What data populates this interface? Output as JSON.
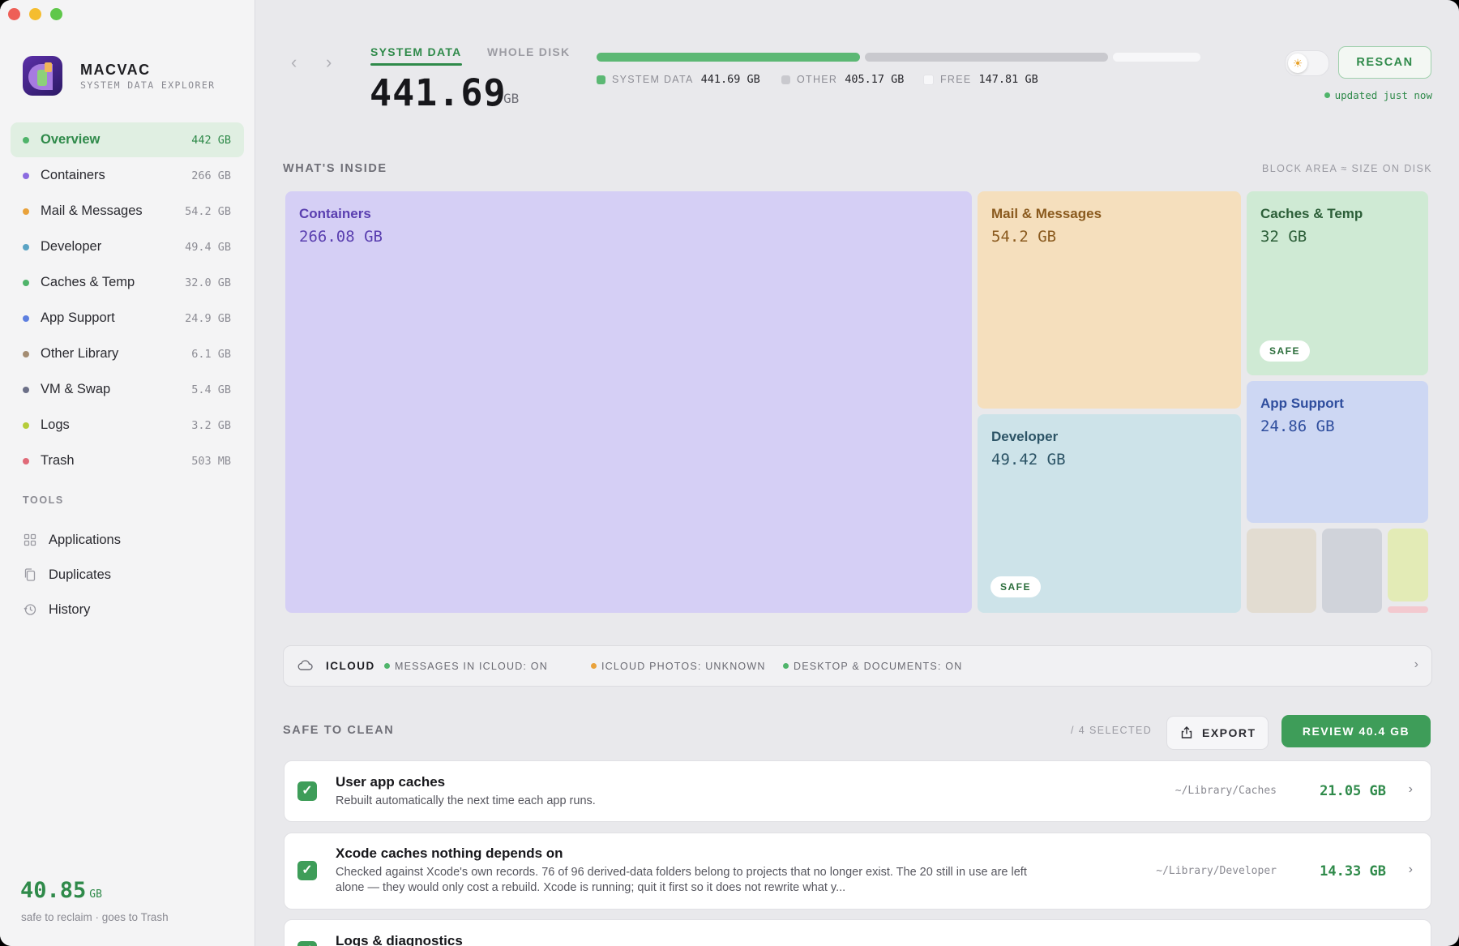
{
  "app": {
    "name": "MACVAC",
    "subtitle": "SYSTEM DATA EXPLORER"
  },
  "sidebar": {
    "items": [
      {
        "label": "Overview",
        "size": "442 GB",
        "color": "#4fb46a",
        "active": true
      },
      {
        "label": "Containers",
        "size": "266 GB",
        "color": "#8b6be0"
      },
      {
        "label": "Mail & Messages",
        "size": "54.2 GB",
        "color": "#e9a23b"
      },
      {
        "label": "Developer",
        "size": "49.4 GB",
        "color": "#5aa3c4"
      },
      {
        "label": "Caches & Temp",
        "size": "32.0 GB",
        "color": "#4fb46a"
      },
      {
        "label": "App Support",
        "size": "24.9 GB",
        "color": "#5d7fe0"
      },
      {
        "label": "Other Library",
        "size": "6.1 GB",
        "color": "#a48d73"
      },
      {
        "label": "VM & Swap",
        "size": "5.4 GB",
        "color": "#6c7088"
      },
      {
        "label": "Logs",
        "size": "3.2 GB",
        "color": "#b5cc3a"
      },
      {
        "label": "Trash",
        "size": "503 MB",
        "color": "#e06a78"
      }
    ],
    "tools_title": "TOOLS",
    "tools": [
      {
        "label": "Applications",
        "icon": "grid-icon"
      },
      {
        "label": "Duplicates",
        "icon": "duplicate-files-icon"
      },
      {
        "label": "History",
        "icon": "clock-history-icon"
      }
    ],
    "reclaim": {
      "value": "40.85",
      "unit": "GB",
      "note": "safe to reclaim · goes to Trash"
    }
  },
  "header": {
    "tabs": [
      {
        "label": "SYSTEM DATA",
        "selected": true
      },
      {
        "label": "WHOLE DISK",
        "selected": false
      }
    ],
    "total_value": "441.69",
    "total_unit": "GB",
    "usage": [
      {
        "label": "SYSTEM DATA",
        "value": "441.69 GB",
        "color": "#5cb874"
      },
      {
        "label": "OTHER",
        "value": "405.17 GB",
        "color": "#c9c9ce"
      },
      {
        "label": "FREE",
        "value": "147.81 GB",
        "color": "#f7f7f9"
      }
    ],
    "rescan_label": "RESCAN",
    "updated": "updated just now"
  },
  "treemap": {
    "title": "WHAT'S INSIDE",
    "note": "BLOCK AREA ≈ SIZE ON DISK",
    "tiles": [
      {
        "name": "Containers",
        "size": "266.08 GB",
        "bg": "#d5cff5",
        "fg": "#5a3fb0"
      },
      {
        "name": "Mail & Messages",
        "size": "54.2 GB",
        "bg": "#f5dfbd",
        "fg": "#8a5a1e"
      },
      {
        "name": "Caches & Temp",
        "size": "32 GB",
        "bg": "#cfead4",
        "fg": "#2c5e38",
        "badge": "SAFE"
      },
      {
        "name": "Developer",
        "size": "49.42 GB",
        "bg": "#cde3e9",
        "fg": "#2c5466",
        "badge": "SAFE"
      },
      {
        "name": "App Support",
        "size": "24.86 GB",
        "bg": "#cdd7f3",
        "fg": "#2f4e9e"
      }
    ],
    "small_tiles": [
      "#e2dcd1",
      "#d0d3da",
      "#e3ebb6",
      "#f3c9cf"
    ]
  },
  "icloud": {
    "title": "ICLOUD",
    "statuses": [
      {
        "text": "MESSAGES IN ICLOUD: ON",
        "color": "#4fb46a"
      },
      {
        "text": "ICLOUD PHOTOS: UNKNOWN",
        "color": "#e9a23b"
      },
      {
        "text": "DESKTOP & DOCUMENTS: ON",
        "color": "#4fb46a"
      }
    ]
  },
  "safe_to_clean": {
    "title": "SAFE TO CLEAN",
    "selected": "/ 4 SELECTED",
    "export_label": "EXPORT",
    "review_label": "REVIEW 40.4 GB",
    "rows": [
      {
        "title": "User app caches",
        "desc": "Rebuilt automatically the next time each app runs.",
        "path": "~/Library/Caches",
        "size": "21.05 GB"
      },
      {
        "title": "Xcode caches nothing depends on",
        "desc": "Checked against Xcode's own records. 76 of 96 derived-data folders belong to projects that no longer exist. The 20 still in use are left alone — they would only cost a rebuild. Xcode is running; quit it first so it does not rewrite what y...",
        "path": "~/Library/Developer",
        "size": "14.33 GB"
      },
      {
        "title": "Logs & diagnostics",
        "desc": "",
        "path": "",
        "size": ""
      }
    ]
  }
}
